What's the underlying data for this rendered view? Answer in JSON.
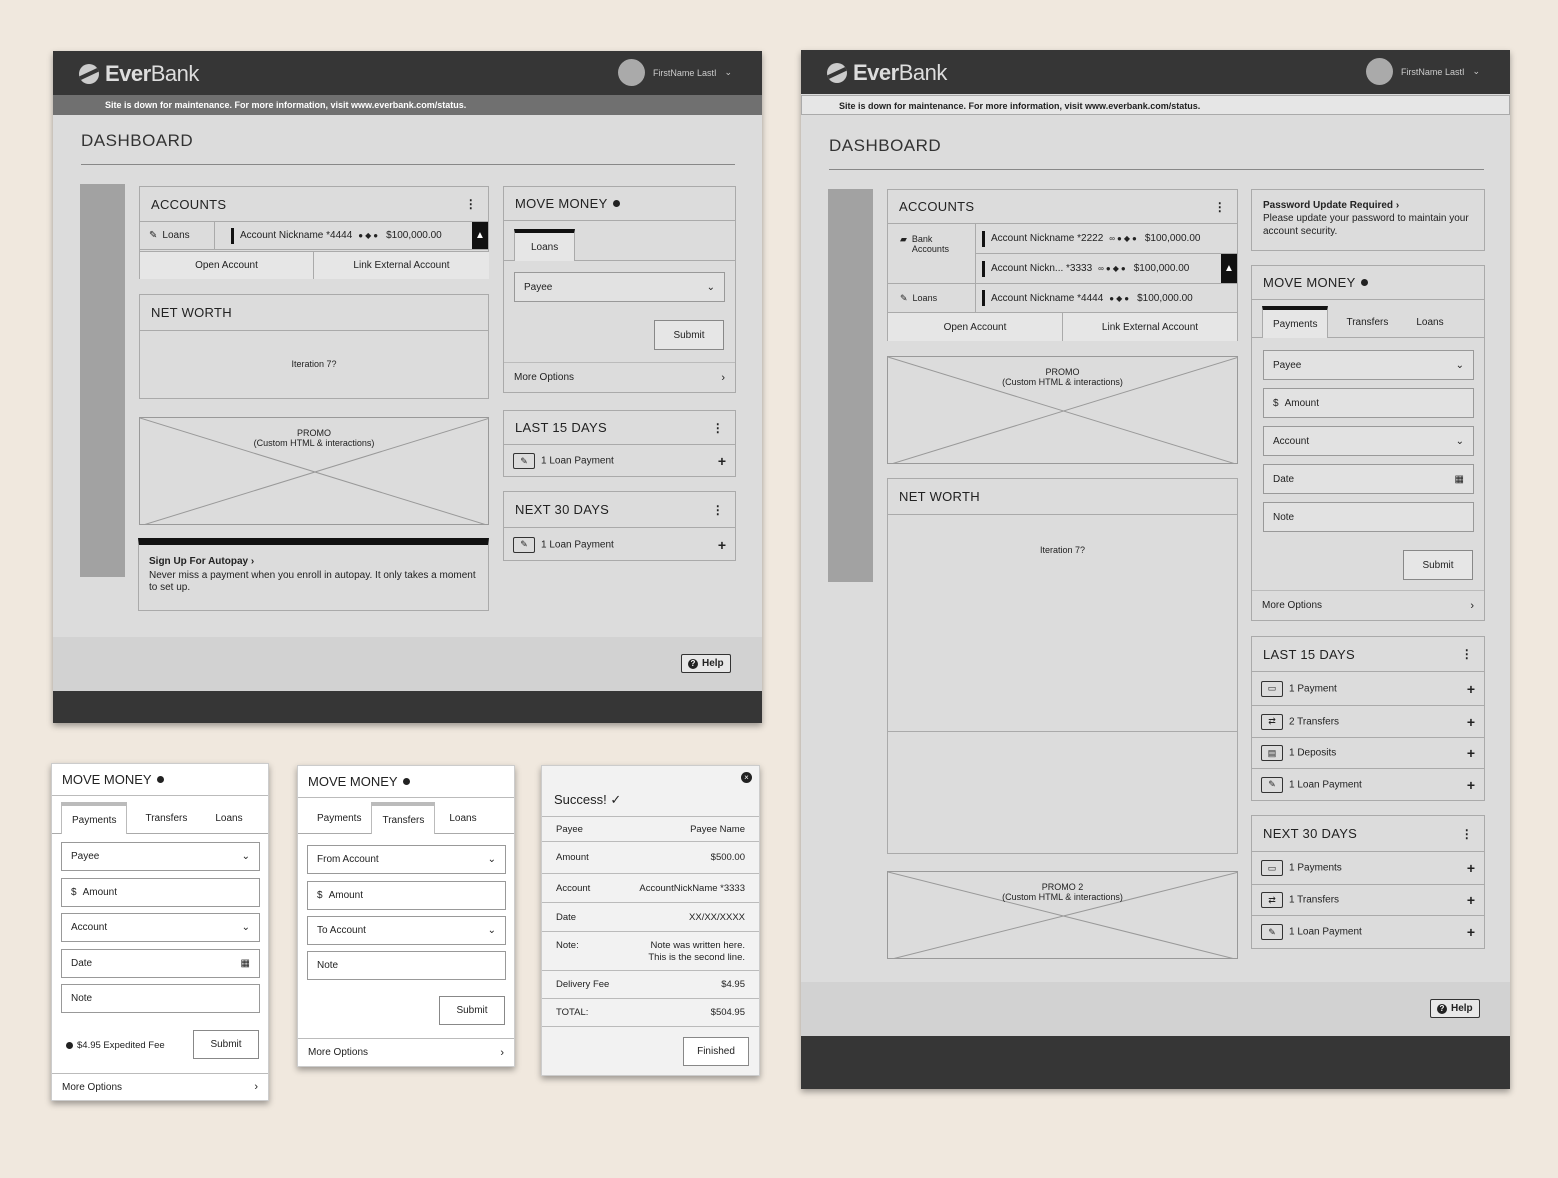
{
  "brand": {
    "name_bold": "Ever",
    "name_light": "Bank"
  },
  "user": {
    "name": "FirstName LastI"
  },
  "banner": "Site is down for maintenance. For more information, visit www.everbank.com/status.",
  "page_title": "DASHBOARD",
  "accounts": {
    "title": "ACCOUNTS",
    "bank_label": "Bank Accounts",
    "loans_label": "Loans",
    "left_loan": {
      "nickname": "Account Nickname *4444",
      "balance": "$100,000.00"
    },
    "right_rows": [
      {
        "nickname": "Account Nickname *2222",
        "balance": "$100,000.00"
      },
      {
        "nickname": "Account Nickn... *3333",
        "balance": "$100,000.00"
      },
      {
        "nickname": "Account Nickname *4444",
        "balance": "$100,000.00"
      }
    ],
    "open": "Open Account",
    "link": "Link External Account"
  },
  "net_worth": {
    "title": "NET WORTH",
    "body": "Iteration 7?"
  },
  "promo": {
    "title": "PROMO",
    "sub": "(Custom HTML & interactions)",
    "title2": "PROMO 2"
  },
  "autopay": {
    "title": "Sign Up For Autopay",
    "body": "Never miss a payment when you enroll in autopay. It only takes a moment to set up."
  },
  "password": {
    "title": "Password Update Required",
    "body": "Please update your password to maintain your account security."
  },
  "move_money": {
    "title": "MOVE MONEY",
    "tabs": [
      "Payments",
      "Transfers",
      "Loans"
    ],
    "payee": "Payee",
    "amount": "Amount",
    "dollar": "$",
    "account": "Account",
    "date": "Date",
    "note": "Note",
    "submit": "Submit",
    "more": "More Options",
    "from": "From Account",
    "to": "To Account",
    "fee": "$4.95 Expedited Fee"
  },
  "last15": {
    "title": "LAST 15 DAYS",
    "left_items": [
      "1 Loan Payment"
    ],
    "right_items": [
      "1 Payment",
      "2 Transfers",
      "1 Deposits",
      "1 Loan Payment"
    ]
  },
  "next30": {
    "title": "NEXT 30 DAYS",
    "left_items": [
      "1 Loan Payment"
    ],
    "right_items": [
      "1 Payments",
      "1 Transfers",
      "1 Loan Payment"
    ]
  },
  "help": "Help",
  "success": {
    "title": "Success!",
    "rows": [
      [
        "Payee",
        "Payee Name"
      ],
      [
        "Amount",
        "$500.00"
      ],
      [
        "Account",
        "AccountNickName *3333"
      ],
      [
        "Date",
        "XX/XX/XXXX"
      ],
      [
        "Note:",
        "Note was written here. This is the second line."
      ],
      [
        "Delivery Fee",
        "$4.95"
      ],
      [
        "TOTAL:",
        "$504.95"
      ]
    ],
    "finish": "Finished"
  }
}
